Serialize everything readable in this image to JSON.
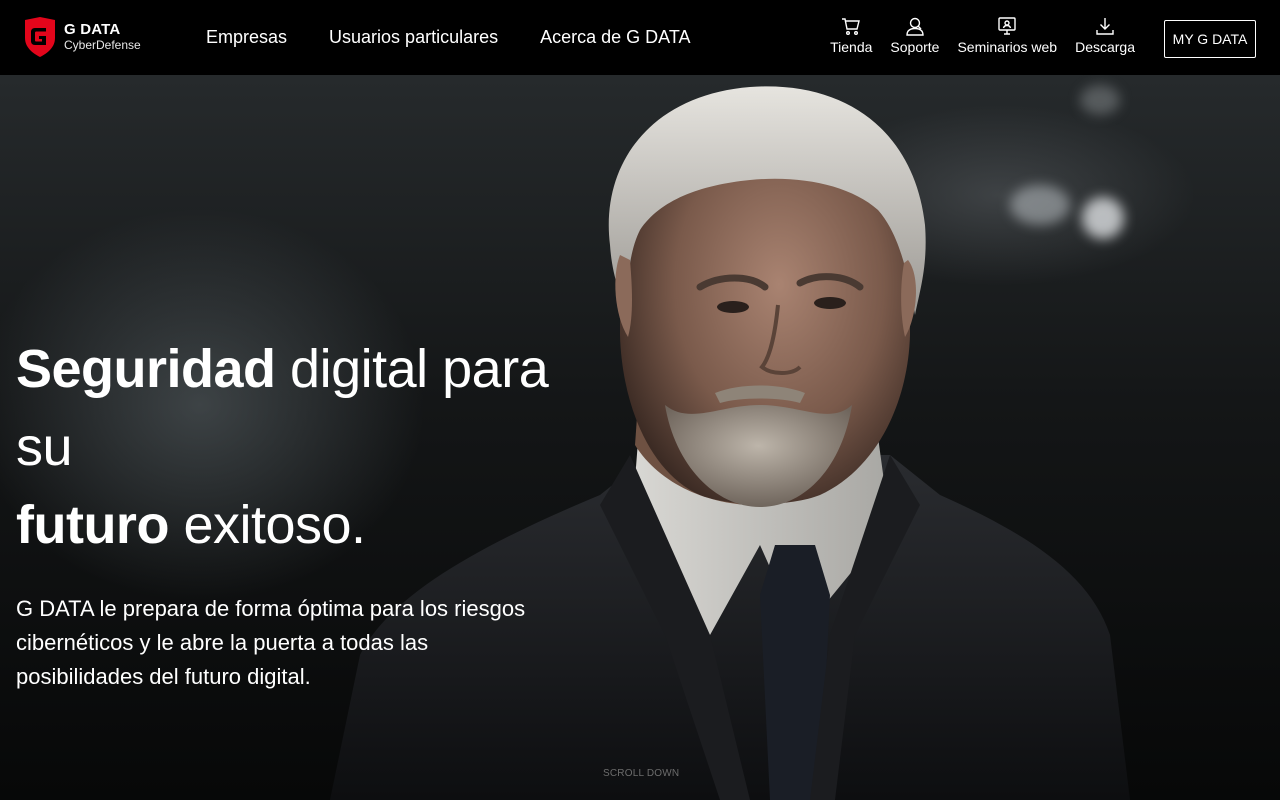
{
  "brand": {
    "name": "G DATA",
    "tagline": "CyberDefense",
    "accent": "#e3051b"
  },
  "nav": {
    "items": [
      {
        "label": "Empresas"
      },
      {
        "label": "Usuarios particulares"
      },
      {
        "label": "Acerca de G DATA"
      }
    ]
  },
  "quicklinks": [
    {
      "label": "Tienda",
      "icon": "cart-icon"
    },
    {
      "label": "Soporte",
      "icon": "support-user-icon"
    },
    {
      "label": "Seminarios web",
      "icon": "webinar-icon"
    },
    {
      "label": "Descarga",
      "icon": "download-icon"
    }
  ],
  "account_button": "MY G DATA",
  "hero": {
    "headline_line1_bold": "Seguridad",
    "headline_line1_rest": " digital para su",
    "headline_line2_bold": "futuro",
    "headline_line2_rest": " exitoso.",
    "lede": "G DATA le prepara de forma óptima para los riesgos cibernéticos y le abre la puerta a todas las posibilidades del futuro digital.",
    "image": "portrait of grey-haired man in dark suit",
    "scroll_hint": "SCROLL DOWN"
  }
}
